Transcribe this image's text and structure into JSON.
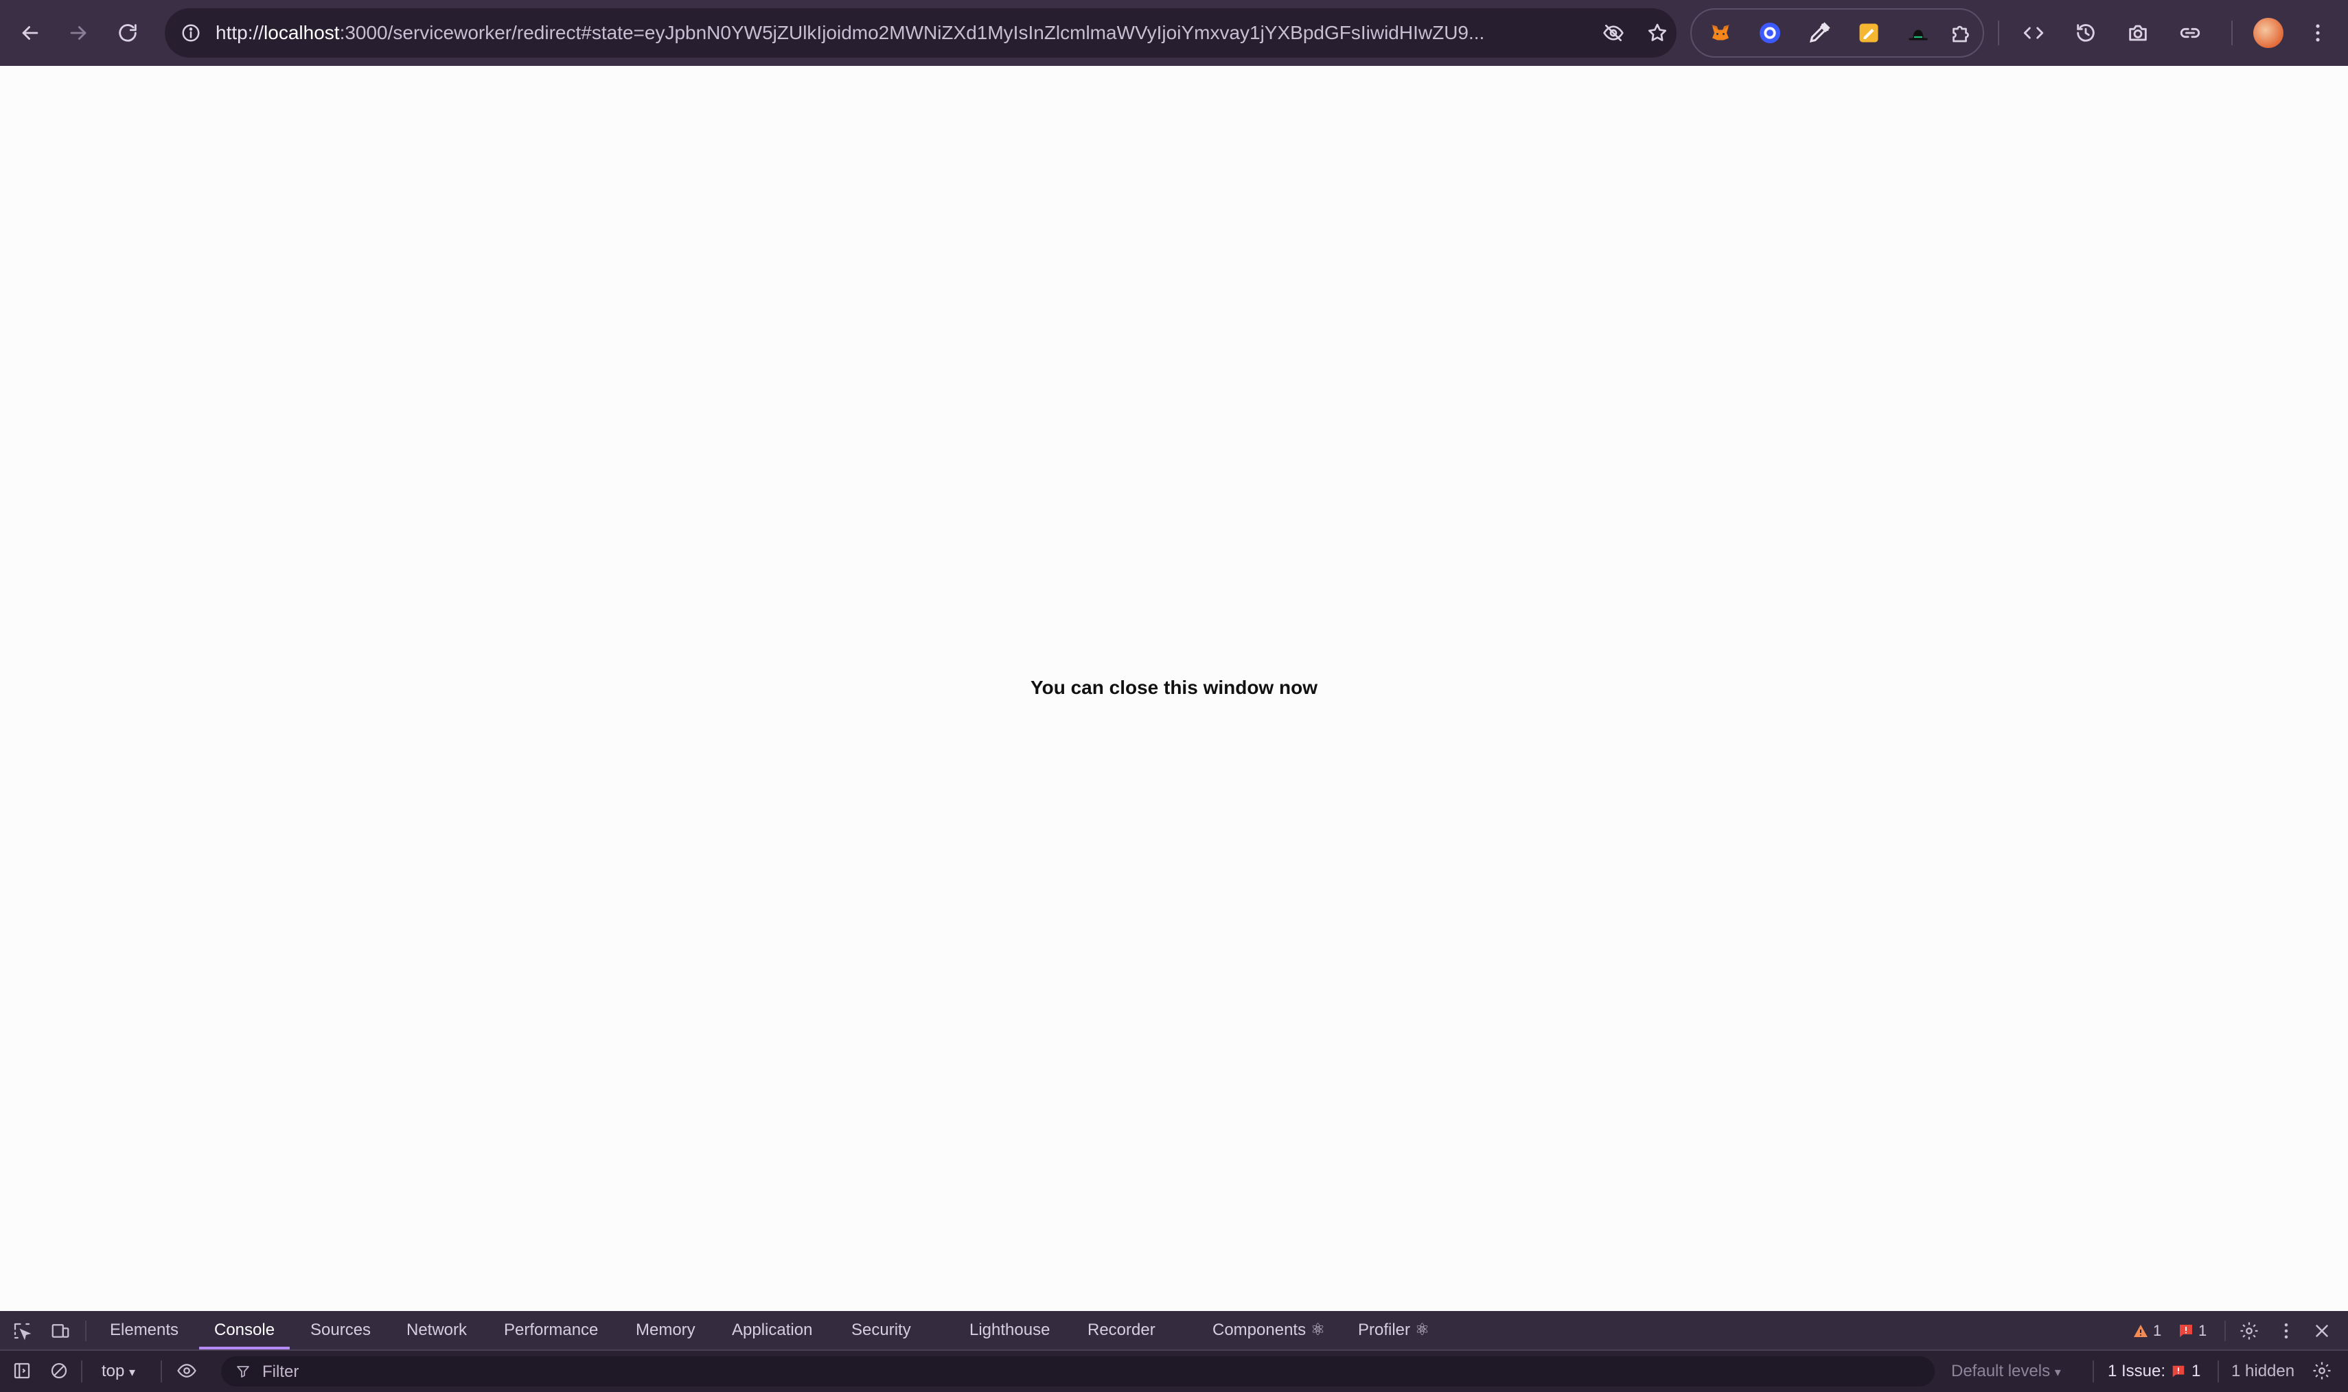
{
  "browser": {
    "url_scheme": "http://",
    "url_host": "localhost",
    "url_rest": ":3000/serviceworker/redirect#state=eyJpbnN0YW5jZUlkIjoidmo2MWNiZXd1MyIsInZlcmlmaWVyIjoiYmxvay1jYXBpdGFsIiwidHIwZU9..."
  },
  "page": {
    "message": "You can close this window now"
  },
  "devtools": {
    "tabs": [
      {
        "label": "Elements"
      },
      {
        "label": "Console"
      },
      {
        "label": "Sources"
      },
      {
        "label": "Network"
      },
      {
        "label": "Performance"
      },
      {
        "label": "Memory"
      },
      {
        "label": "Application"
      },
      {
        "label": "Security"
      },
      {
        "label": "Lighthouse"
      },
      {
        "label": "Recorder"
      },
      {
        "label": "Components ⚛"
      },
      {
        "label": "Profiler ⚛"
      }
    ],
    "active_tab": "Console",
    "warning_count": "1",
    "error_count": "1",
    "context": "top",
    "filter_placeholder": "Filter",
    "levels_label": "Default levels",
    "issues_label": "1 Issue:",
    "issues_count": "1",
    "hidden_label": "1 hidden"
  },
  "colors": {
    "toolbar_bg": "#3a2f45",
    "devtools_bg": "#2a2233",
    "active_tab_underline": "#b58cf5",
    "warning": "#f28b54",
    "error": "#e8453c"
  }
}
